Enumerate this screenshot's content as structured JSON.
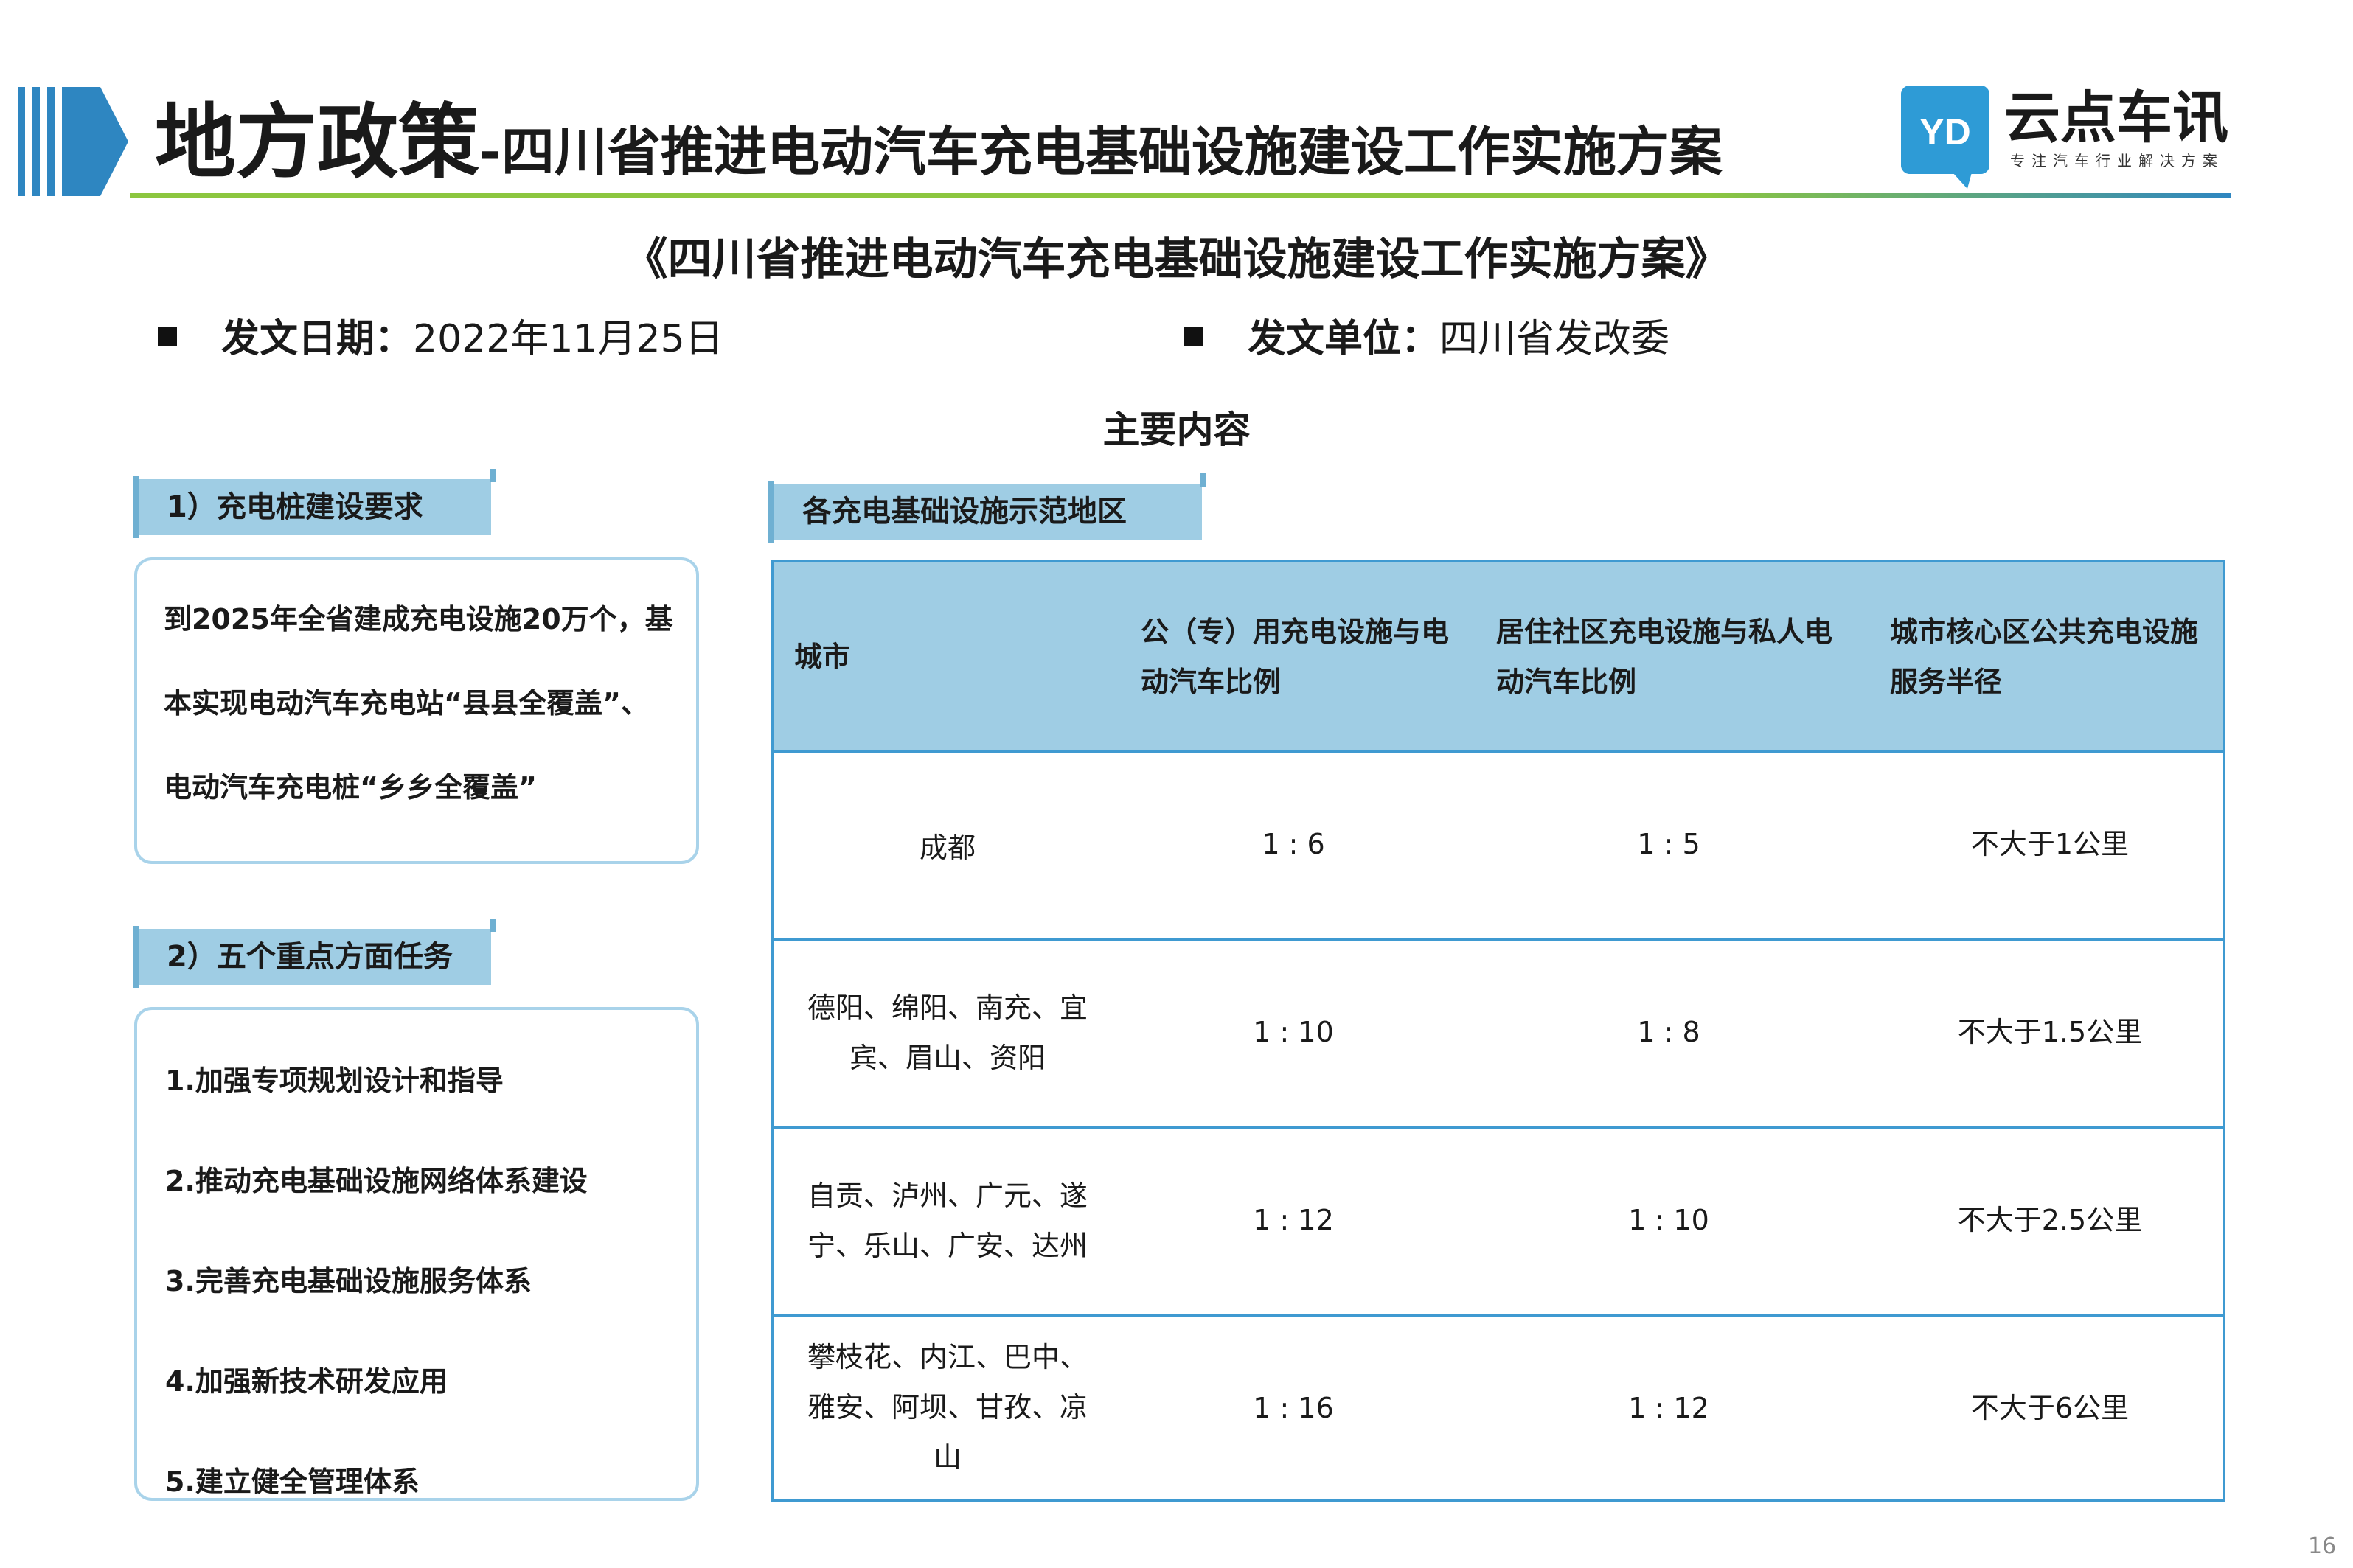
{
  "header": {
    "title_main": "地方政策",
    "title_sub": "-四川省推进电动汽车充电基础设施建设工作实施方案",
    "logo_name": "云点车讯",
    "logo_tagline": "专注汽车行业解决方案",
    "colors": {
      "accent_blue": "#2e86c1",
      "accent_green": "#8cc63f",
      "tab_fill": "#9fcde4"
    }
  },
  "doc_title": "《四川省推进电动汽车充电基础设施建设工作实施方案》",
  "meta": {
    "date_label": "发文日期：",
    "date_value": "2022年11月25日",
    "issuer_label": "发文单位：",
    "issuer_value": "四川省发改委"
  },
  "main_content_label": "主要内容",
  "section1": {
    "tab": "1）充电桩建设要求",
    "lines": [
      "到2025年全省建成充电设施20万个，基",
      "本实现电动汽车充电站“县县全覆盖”、",
      "电动汽车充电桩“乡乡全覆盖”"
    ]
  },
  "section2": {
    "tab": "2）五个重点方面任务",
    "items": [
      "1.加强专项规划设计和指导",
      "2.推动充电基础设施网络体系建设",
      "3.完善充电基础设施服务体系",
      "4.加强新技术研发应用",
      "5.建立健全管理体系"
    ]
  },
  "table": {
    "tab": "各充电基础设施示范地区",
    "headers": {
      "city": "城市",
      "public_ratio": [
        "公（专）用充电设施与电",
        "动汽车比例"
      ],
      "resident_ratio": [
        "居住社区充电设施与私人电",
        "动汽车比例"
      ],
      "radius": [
        "城市核心区公共充电设施",
        "服务半径"
      ]
    },
    "rows": [
      {
        "city": [
          "成都"
        ],
        "public_ratio": "1 : 6",
        "resident_ratio": "1 : 5",
        "radius": "不大于1公里"
      },
      {
        "city": [
          "德阳、绵阳、南充、宜",
          "宾、眉山、资阳"
        ],
        "public_ratio": "1 : 10",
        "resident_ratio": "1 : 8",
        "radius": "不大于1.5公里"
      },
      {
        "city": [
          "自贡、泸州、广元、遂",
          "宁、乐山、广安、达州"
        ],
        "public_ratio": "1 : 12",
        "resident_ratio": "1 : 10",
        "radius": "不大于2.5公里"
      },
      {
        "city": [
          "攀枝花、内江、巴中、",
          "雅安、阿坝、甘孜、凉",
          "山"
        ],
        "public_ratio": "1 : 16",
        "resident_ratio": "1 : 12",
        "radius": "不大于6公里"
      }
    ]
  },
  "page_number": "16"
}
